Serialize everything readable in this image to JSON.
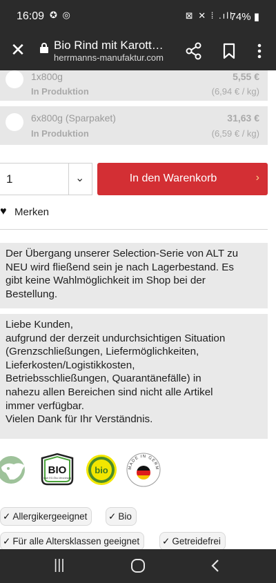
{
  "status_bar": {
    "time": "16:09",
    "left_icons": "✪ ◎",
    "right_icons": "⊠ ✕ ⁞ .ıll",
    "battery": "74%"
  },
  "toolbar": {
    "close_icon": "close-icon",
    "title": "Bio Rind mit Karott…",
    "url": "herrmanns-manufaktur.com"
  },
  "options": [
    {
      "name": "1x800g",
      "status": "In Produktion",
      "price": "5,55 €",
      "unit_price": "(6,94 € / kg)"
    },
    {
      "name": "6x800g (Sparpaket)",
      "status": "In Produktion",
      "price": "31,63 €",
      "unit_price": "(6,59 € / kg)"
    }
  ],
  "quantity": {
    "value": "1"
  },
  "cart": {
    "label": "In den Warenkorb",
    "arrow": "›"
  },
  "wishlist": {
    "label": "Merken"
  },
  "notice1": {
    "lines": [
      "Der Übergang unserer Selection-Serie von ALT zu",
      "NEU wird fließend sein je nach Lagerbestand. Es",
      "gibt keine Wahlmöglichkeit im Shop bei der",
      "Bestellung."
    ]
  },
  "notice2": {
    "lines": [
      "Liebe Kunden,",
      "aufgrund der derzeit undurchsichtigen Situation",
      "(Grenzschließungen, Liefermöglichkeiten,",
      "Lieferkosten/Logistikkosten,",
      "Betriebsschließungen, Quarantänefälle) in",
      "nahezu allen Bereichen sind nicht alle Artikel",
      "immer verfügbar.",
      "Vielen Dank für Ihr Verständnis."
    ]
  },
  "logos": {
    "bio_label": "BIO",
    "bio_round_label": "bio",
    "made_in_germany": "MADE IN GERMANY"
  },
  "tags": [
    {
      "label": "Allergikergeeignet"
    },
    {
      "label": "Bio"
    },
    {
      "label": "Für alle Altersklassen geeignet"
    },
    {
      "label": "Getreidefrei"
    }
  ],
  "colors": {
    "accent_red": "#d32f34",
    "chrome_dark": "#2b2b2b",
    "panel_grey": "#e9e9e9"
  }
}
